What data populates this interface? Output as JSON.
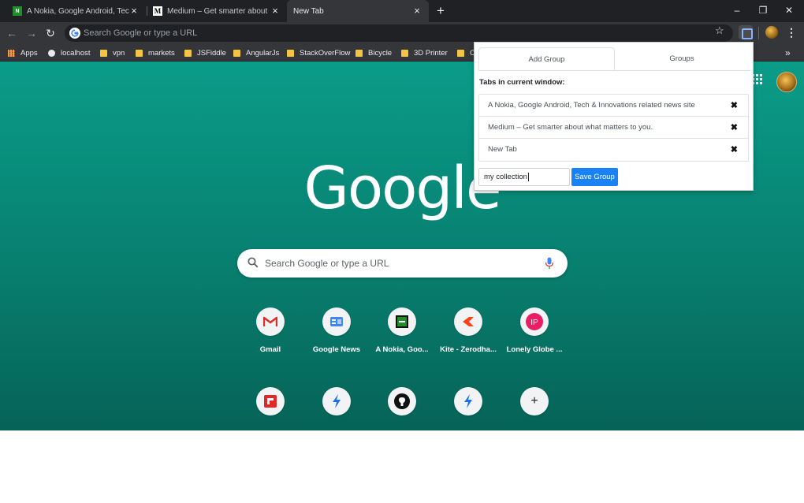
{
  "tabs": [
    {
      "title": "A Nokia, Google Android, Tech &",
      "favicon": "nokia-favicon",
      "active": false
    },
    {
      "title": "Medium – Get smarter about wh",
      "favicon": "medium-favicon",
      "active": false
    },
    {
      "title": "New Tab",
      "favicon": "",
      "active": true
    }
  ],
  "window_controls": {
    "minimize": "–",
    "restore": "❐",
    "close": "✕"
  },
  "omnibox": {
    "placeholder": "Search Google or type a URL"
  },
  "bookmarks": [
    "Apps",
    "localhost",
    "vpn",
    "markets",
    "JSFiddle",
    "AngularJs",
    "StackOverFlow",
    "Bicycle",
    "3D Printer",
    "C"
  ],
  "bookmarks_more": "»",
  "ntp": {
    "logo": "Google",
    "search_placeholder": "Search Google or type a URL",
    "shortcuts": [
      {
        "label": "Gmail",
        "icon": "gmail-icon"
      },
      {
        "label": "Google News",
        "icon": "google-news-icon"
      },
      {
        "label": "A Nokia, Goo...",
        "icon": "nokia-icon"
      },
      {
        "label": "Kite - Zerodha...",
        "icon": "kite-icon"
      },
      {
        "label": "Lonely Globe ...",
        "icon": "ip-icon"
      },
      {
        "label": "",
        "icon": "flipboard-icon"
      },
      {
        "label": "",
        "icon": "lightning-icon"
      },
      {
        "label": "",
        "icon": "github-icon"
      },
      {
        "label": "",
        "icon": "lightning-icon"
      },
      {
        "label": "",
        "icon": "add-shortcut-icon"
      }
    ]
  },
  "popup": {
    "tab_add": "Add Group",
    "tab_groups": "Groups",
    "section_title": "Tabs in current window:",
    "items": [
      "A Nokia, Google Android, Tech & Innovations related news site",
      "Medium – Get smarter about what matters to you.",
      "New Tab"
    ],
    "remove_label": "✖",
    "input_value": "my collection",
    "save_label": "Save Group"
  },
  "colors": {
    "ntp_background": "#0a9c88",
    "save_button": "#1a82f7",
    "tab_strip": "#202124",
    "toolbar": "#35363a"
  }
}
